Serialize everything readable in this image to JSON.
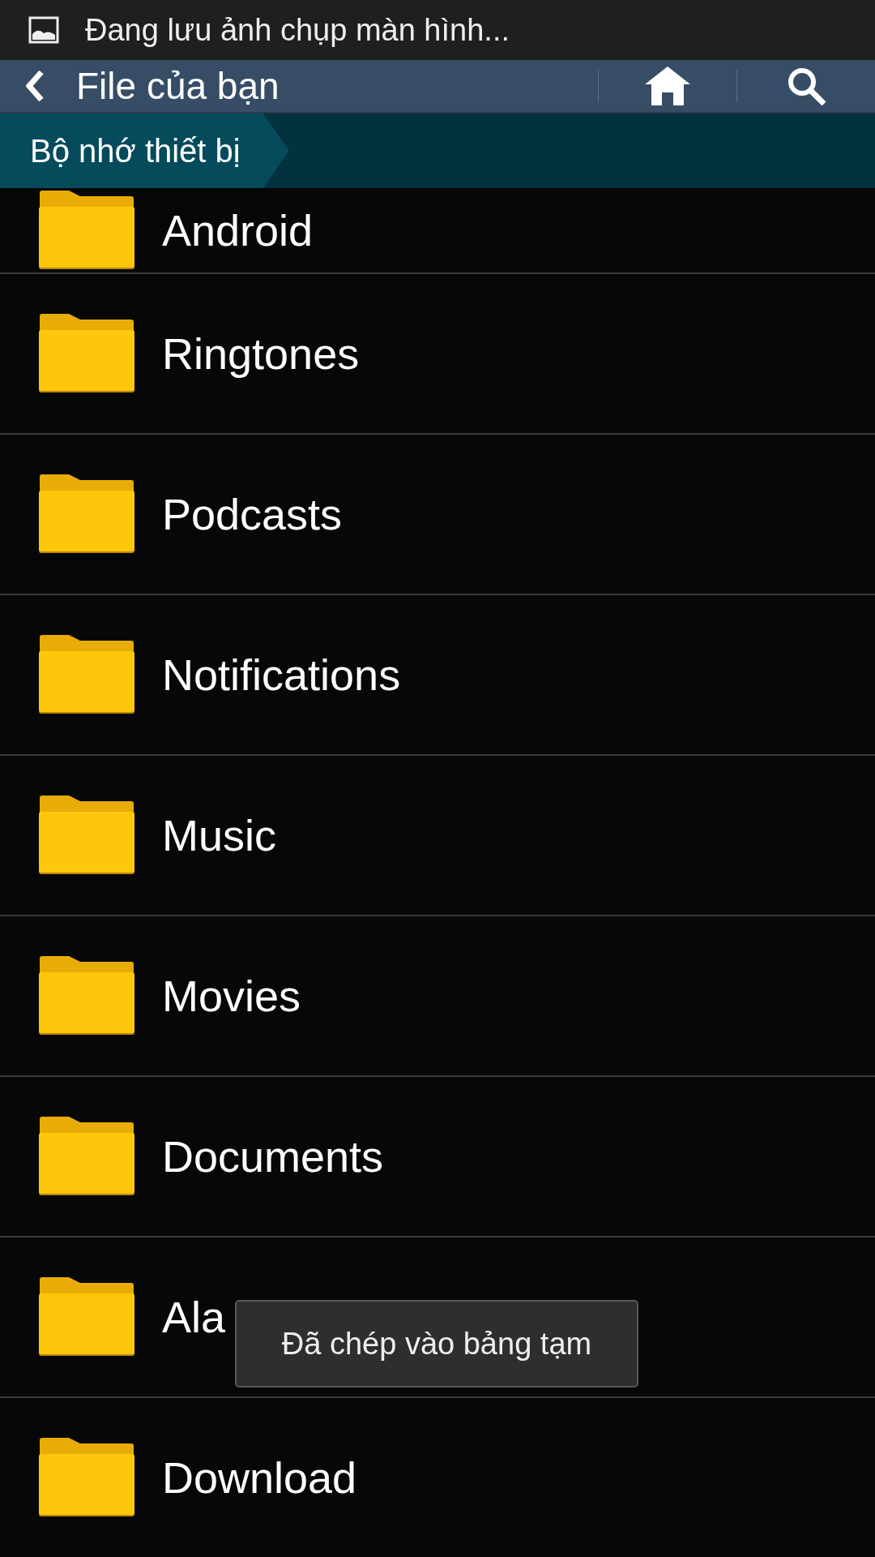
{
  "status_bar": {
    "notification": "Đang lưu ảnh chụp màn hình..."
  },
  "action_bar": {
    "title": "File của bạn"
  },
  "breadcrumb": [
    "Bộ nhớ thiết bị"
  ],
  "folders": [
    {
      "name": "Android"
    },
    {
      "name": "Ringtones"
    },
    {
      "name": "Podcasts"
    },
    {
      "name": "Notifications"
    },
    {
      "name": "Music"
    },
    {
      "name": "Movies"
    },
    {
      "name": "Documents"
    },
    {
      "name": "Ala"
    },
    {
      "name": "Download"
    }
  ],
  "toast": "Đã chép vào bảng tạm"
}
